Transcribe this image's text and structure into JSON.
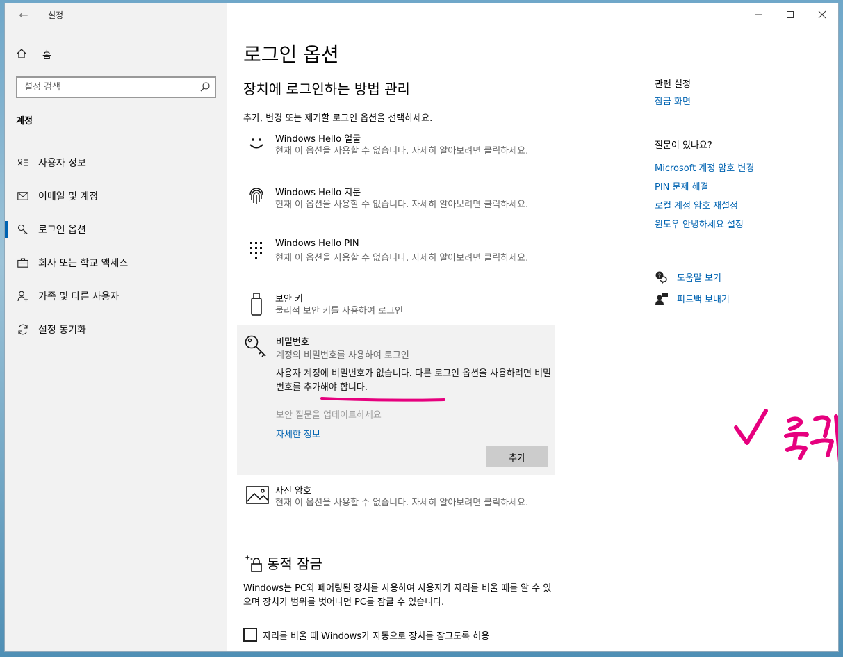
{
  "window": {
    "app_title": "설정"
  },
  "sidebar": {
    "home_label": "홈",
    "search_placeholder": "설정 검색",
    "section_heading": "계정",
    "items": [
      {
        "label": "사용자 정보"
      },
      {
        "label": "이메일 및 계정"
      },
      {
        "label": "로그인 옵션"
      },
      {
        "label": "회사 또는 학교 액세스"
      },
      {
        "label": "가족 및 다른 사용자"
      },
      {
        "label": "설정 동기화"
      }
    ]
  },
  "main": {
    "title": "로그인 옵션",
    "subtitle": "장치에 로그인하는 방법 관리",
    "description": "추가, 변경 또는 제거할 로그인 옵션을 선택하세요.",
    "options": [
      {
        "title": "Windows Hello 얼굴",
        "desc": "현재 이 옵션을 사용할 수 없습니다. 자세히 알아보려면 클릭하세요."
      },
      {
        "title": "Windows Hello 지문",
        "desc": "현재 이 옵션을 사용할 수 없습니다. 자세히 알아보려면 클릭하세요."
      },
      {
        "title": "Windows Hello PIN",
        "desc": "현재 이 옵션을 사용할 수 없습니다. 자세히 알아보려면 클릭하세요."
      },
      {
        "title": "보안 키",
        "desc": "물리적 보안 키를 사용하여 로그인"
      }
    ],
    "password": {
      "title": "비밀번호",
      "desc": "계정의 비밀번호를 사용하여 로그인",
      "message": "사용자 계정에 비밀번호가 없습니다. 다른 로그인 옵션을 사용하려면 비밀번호를 추가해야 합니다.",
      "update_label": "보안 질문을 업데이트하세요",
      "more_info": "자세한 정보",
      "add_button": "추가"
    },
    "picture_password": {
      "title": "사진 암호",
      "desc": "현재 이 옵션을 사용할 수 없습니다. 자세히 알아보려면 클릭하세요."
    },
    "dynamic_lock": {
      "title": "동적 잠금",
      "desc": "Windows는 PC와 페어링된 장치를 사용하여 사용자가 자리를 비울 때를 알 수 있으며 장치가 범위를 벗어나면 PC를 잠글 수 있습니다.",
      "checkbox_label": "자리를 비울 때 Windows가 자동으로 장치를 잠그도록 허용",
      "checked": false
    }
  },
  "related": {
    "heading": "관련 설정",
    "lock_screen": "잠금 화면",
    "question_heading": "질문이 있나요?",
    "links": [
      "Microsoft 계정 암호 변경",
      "PIN 문제 해결",
      "로컬 계정 암호 재설정",
      "윈도우 안녕하세요 설정"
    ],
    "help_label": "도움말 보기",
    "feedback_label": "피드백 보내기"
  },
  "colors": {
    "accent": "#0063b1",
    "annotation": "#e6007e"
  }
}
